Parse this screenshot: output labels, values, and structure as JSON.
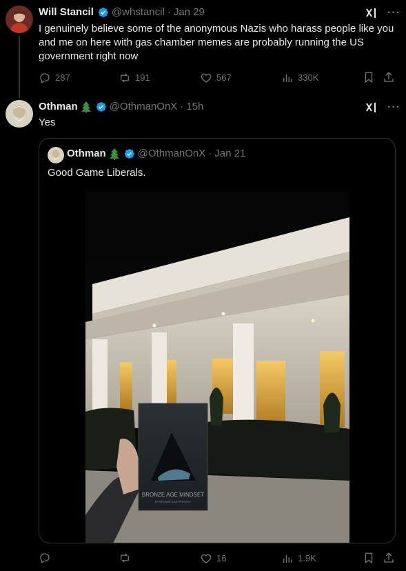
{
  "tweet1": {
    "name": "Will Stancil",
    "handle": "@whstancil",
    "separator": "·",
    "time": "Jan 29",
    "text": "I genuinely believe some of the anonymous Nazis who harass people like you and me on here with gas chamber memes are probably running the US government right now",
    "actions": {
      "replies": "287",
      "reposts": "191",
      "likes": "567",
      "views": "330K"
    }
  },
  "tweet2": {
    "name": "Othman",
    "handle": "@OthmanOnX",
    "separator": "·",
    "time": "15h",
    "text": "Yes",
    "actions": {
      "likes": "16",
      "views": "1.9K"
    }
  },
  "quoted": {
    "name": "Othman",
    "handle": "@OthmanOnX",
    "separator": "·",
    "time": "Jan 21",
    "text": "Good Game Liberals.",
    "media": {
      "book_title": "BRONZE AGE MINDSET",
      "book_author": "BY BRONZE AGE PERVERT"
    }
  },
  "icons": {
    "verified": "verified-badge-icon",
    "tree": "evergreen-tree-emoji",
    "grok": "grok-icon",
    "more": "more-icon"
  },
  "colors": {
    "background": "#000000",
    "text": "#e7e9ea",
    "secondary": "#71767b",
    "verified": "#1d9bf0",
    "border": "#2f3336"
  }
}
